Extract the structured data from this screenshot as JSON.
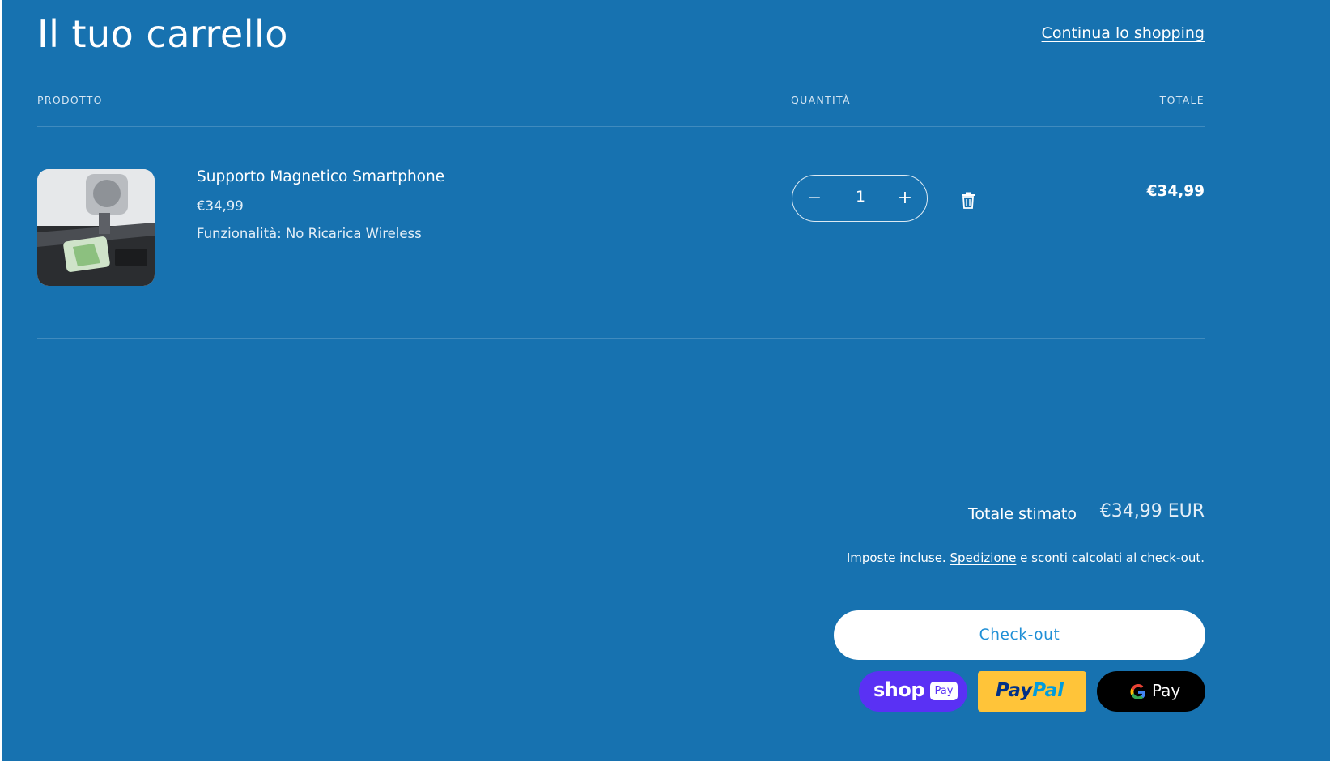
{
  "cart": {
    "title": "Il tuo carrello",
    "continue_link": "Continua lo shopping"
  },
  "table": {
    "headers": {
      "product": "PRODOTTO",
      "quantity": "QUANTITÀ",
      "total": "TOTALE"
    }
  },
  "item": {
    "name": "Supporto Magnetico Smartphone",
    "price": "€34,99",
    "variant": "Funzionalità: No Ricarica Wireless",
    "quantity": "1",
    "line_total": "€34,99",
    "minus_symbol": "−",
    "plus_symbol": "+"
  },
  "summary": {
    "estimated_label": "Totale stimato",
    "estimated_value": "€34,99 EUR",
    "tax_prefix": "Imposte incluse. ",
    "shipping_link": "Spedizione",
    "tax_suffix": " e sconti calcolati al check-out.",
    "checkout_label": "Check-out"
  },
  "payments": {
    "shop_pay_text": "shop",
    "shop_pay_badge": "Pay",
    "paypal_pay": "Pay",
    "paypal_pal": "Pal",
    "gpay_text": "Pay"
  },
  "colors": {
    "background": "#1772b0",
    "shop_pay": "#5a31f4",
    "paypal": "#ffc439",
    "gpay": "#000000"
  }
}
